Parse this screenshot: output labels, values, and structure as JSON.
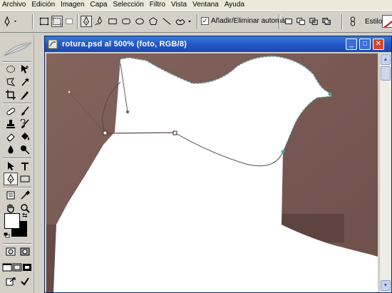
{
  "menubar": {
    "items": [
      "Archivo",
      "Edición",
      "Imagen",
      "Capa",
      "Selección",
      "Filtro",
      "Vista",
      "Ventana",
      "Ayuda"
    ]
  },
  "options": {
    "auto_add_delete_label": "Añadir/Eliminar automát.",
    "auto_add_delete_checked": true,
    "style_label": "Estilo:"
  },
  "document": {
    "title": "rotura.psd al 500% (foto, RGB/8)",
    "min_glyph": "_",
    "max_glyph": "□",
    "close_glyph": "✕"
  },
  "colors": {
    "foreground": "#ffffff",
    "background": "#000000",
    "photo_brown": "#7a5a54",
    "path_stroke": "#5a4a48",
    "selection_dash": "#4aa3a8"
  }
}
